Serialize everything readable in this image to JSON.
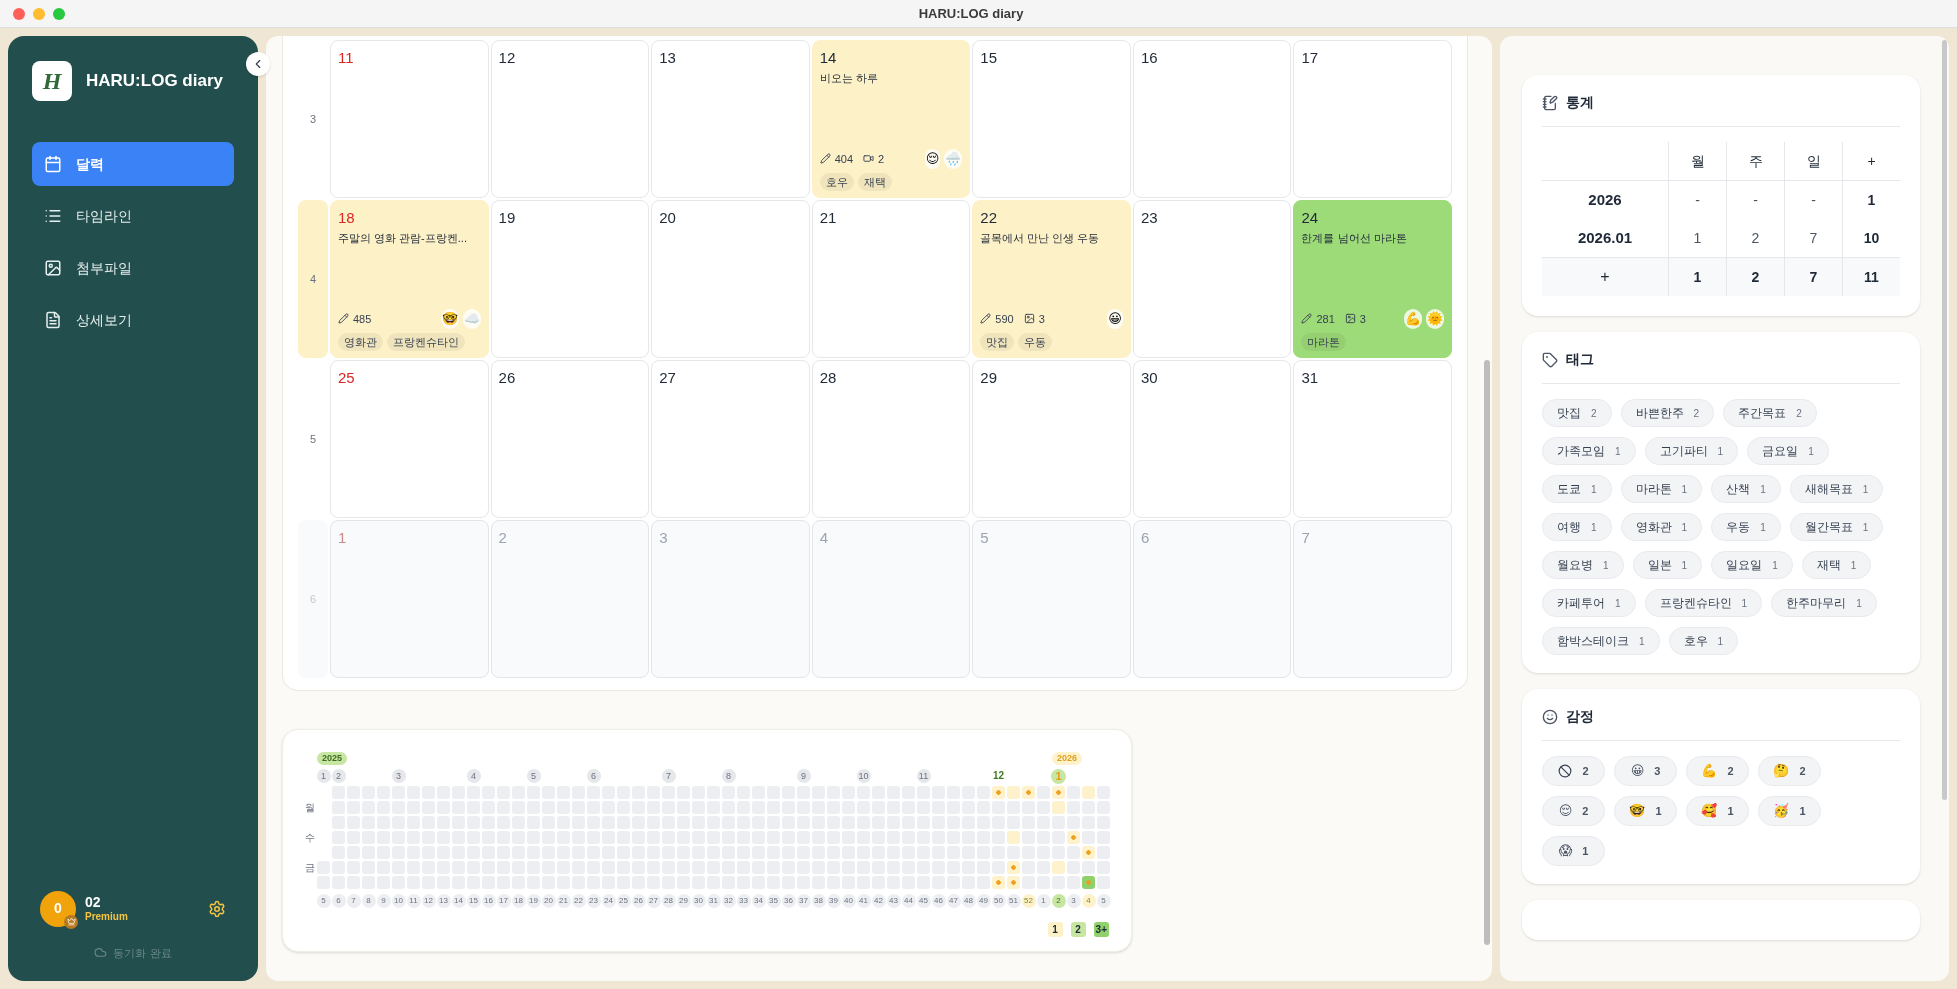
{
  "window": {
    "title": "HARU:LOG diary"
  },
  "sidebar": {
    "logo_letter": "H",
    "app_name": "HARU:LOG diary",
    "items": [
      {
        "label": "달력",
        "selected": true
      },
      {
        "label": "타임라인",
        "selected": false
      },
      {
        "label": "첨부파일",
        "selected": false
      },
      {
        "label": "상세보기",
        "selected": false
      }
    ],
    "user": {
      "avatar_text": "0",
      "name": "02",
      "plan": "Premium"
    },
    "sync_status": "동기화 완료"
  },
  "calendar": {
    "weeks": [
      {
        "label": "3",
        "highlighted": false,
        "days": [
          {
            "date": "11",
            "sunday": true,
            "other_month": false
          },
          {
            "date": "12",
            "sunday": false,
            "other_month": false
          },
          {
            "date": "13",
            "sunday": false,
            "other_month": false
          },
          {
            "date": "14",
            "sunday": false,
            "other_month": false,
            "entry": {
              "title": "비오는 하루",
              "color": "#fdf1c7",
              "chars": "404",
              "media": {
                "kind": "video",
                "count": "2"
              },
              "emojis": [
                "😌",
                "🌧️"
              ],
              "tags": [
                "호우",
                "재택"
              ]
            }
          },
          {
            "date": "15",
            "sunday": false,
            "other_month": false
          },
          {
            "date": "16",
            "sunday": false,
            "other_month": false
          },
          {
            "date": "17",
            "sunday": false,
            "other_month": false
          }
        ]
      },
      {
        "label": "4",
        "highlighted": true,
        "days": [
          {
            "date": "18",
            "sunday": true,
            "other_month": false,
            "entry": {
              "title": "주말의 영화 관람-프랑켄...",
              "color": "#fdf1c7",
              "chars": "485",
              "emojis": [
                "🤓",
                "☁️"
              ],
              "tags": [
                "영화관",
                "프랑켄슈타인"
              ]
            }
          },
          {
            "date": "19",
            "sunday": false,
            "other_month": false
          },
          {
            "date": "20",
            "sunday": false,
            "other_month": false
          },
          {
            "date": "21",
            "sunday": false,
            "other_month": false
          },
          {
            "date": "22",
            "sunday": false,
            "other_month": false,
            "entry": {
              "title": "골목에서 만난 인생 우동",
              "color": "#fdf1c7",
              "chars": "590",
              "media": {
                "kind": "image",
                "count": "3"
              },
              "emojis": [
                "😀"
              ],
              "tags": [
                "맛집",
                "우동"
              ]
            }
          },
          {
            "date": "23",
            "sunday": false,
            "other_month": false
          },
          {
            "date": "24",
            "sunday": false,
            "other_month": false,
            "entry": {
              "title": "한계를 넘어선 마라톤",
              "color": "#9ddb78",
              "chars": "281",
              "media": {
                "kind": "image",
                "count": "3"
              },
              "emojis": [
                "💪",
                "🌞"
              ],
              "tags": [
                "마라톤"
              ]
            }
          }
        ]
      },
      {
        "label": "5",
        "highlighted": false,
        "days": [
          {
            "date": "25",
            "sunday": true,
            "other_month": false
          },
          {
            "date": "26",
            "sunday": false,
            "other_month": false
          },
          {
            "date": "27",
            "sunday": false,
            "other_month": false
          },
          {
            "date": "28",
            "sunday": false,
            "other_month": false
          },
          {
            "date": "29",
            "sunday": false,
            "other_month": false
          },
          {
            "date": "30",
            "sunday": false,
            "other_month": false
          },
          {
            "date": "31",
            "sunday": false,
            "other_month": false
          }
        ]
      },
      {
        "label": "6",
        "highlighted": false,
        "days": [
          {
            "date": "1",
            "sunday": true,
            "other_month": true
          },
          {
            "date": "2",
            "sunday": false,
            "other_month": true
          },
          {
            "date": "3",
            "sunday": false,
            "other_month": true
          },
          {
            "date": "4",
            "sunday": false,
            "other_month": true
          },
          {
            "date": "5",
            "sunday": false,
            "other_month": true
          },
          {
            "date": "6",
            "sunday": false,
            "other_month": true
          },
          {
            "date": "7",
            "sunday": false,
            "other_month": true
          }
        ]
      }
    ]
  },
  "heatmap": {
    "day_labels": [
      "월",
      "수",
      "금"
    ],
    "weeks": [
      {
        "label": "5",
        "kind": "plain",
        "month": {
          "text": "1",
          "kind": "past"
        },
        "year": {
          "text": "2025",
          "kind": "past"
        },
        "days": [
          {
            "kind": "missing"
          },
          {
            "kind": "missing"
          },
          {
            "kind": "missing"
          },
          {
            "kind": "missing"
          },
          {
            "kind": "missing"
          },
          {
            "kind": "none"
          },
          {
            "kind": "none"
          }
        ]
      },
      {
        "label": "6",
        "kind": "plain",
        "month": {
          "text": "2",
          "kind": "past"
        },
        "days": [
          {
            "kind": "none"
          },
          {
            "kind": "none"
          },
          {
            "kind": "none"
          },
          {
            "kind": "none"
          },
          {
            "kind": "none"
          },
          {
            "kind": "none"
          },
          {
            "kind": "none"
          }
        ]
      },
      {
        "label": "7",
        "kind": "plain",
        "days": [
          {
            "kind": "none"
          },
          {
            "kind": "none"
          },
          {
            "kind": "none"
          },
          {
            "kind": "none"
          },
          {
            "kind": "none"
          },
          {
            "kind": "none"
          },
          {
            "kind": "none"
          }
        ]
      },
      {
        "label": "8",
        "kind": "plain",
        "days": [
          {
            "kind": "none"
          },
          {
            "kind": "none"
          },
          {
            "kind": "none"
          },
          {
            "kind": "none"
          },
          {
            "kind": "none"
          },
          {
            "kind": "none"
          },
          {
            "kind": "none"
          }
        ]
      },
      {
        "label": "9",
        "kind": "plain",
        "days": [
          {
            "kind": "none"
          },
          {
            "kind": "none"
          },
          {
            "kind": "none"
          },
          {
            "kind": "none"
          },
          {
            "kind": "none"
          },
          {
            "kind": "none"
          },
          {
            "kind": "none"
          }
        ]
      },
      {
        "label": "10",
        "kind": "plain",
        "month": {
          "text": "3",
          "kind": "past"
        },
        "days": [
          {
            "kind": "none"
          },
          {
            "kind": "none"
          },
          {
            "kind": "none"
          },
          {
            "kind": "none"
          },
          {
            "kind": "none"
          },
          {
            "kind": "none"
          },
          {
            "kind": "none"
          }
        ]
      },
      {
        "label": "11",
        "kind": "plain",
        "days": [
          {
            "kind": "none"
          },
          {
            "kind": "none"
          },
          {
            "kind": "none"
          },
          {
            "kind": "none"
          },
          {
            "kind": "none"
          },
          {
            "kind": "none"
          },
          {
            "kind": "none"
          }
        ]
      },
      {
        "label": "12",
        "kind": "plain",
        "days": [
          {
            "kind": "none"
          },
          {
            "kind": "none"
          },
          {
            "kind": "none"
          },
          {
            "kind": "none"
          },
          {
            "kind": "none"
          },
          {
            "kind": "none"
          },
          {
            "kind": "none"
          }
        ]
      },
      {
        "label": "13",
        "kind": "plain",
        "days": [
          {
            "kind": "none"
          },
          {
            "kind": "none"
          },
          {
            "kind": "none"
          },
          {
            "kind": "none"
          },
          {
            "kind": "none"
          },
          {
            "kind": "none"
          },
          {
            "kind": "none"
          }
        ]
      },
      {
        "label": "14",
        "kind": "plain",
        "days": [
          {
            "kind": "none"
          },
          {
            "kind": "none"
          },
          {
            "kind": "none"
          },
          {
            "kind": "none"
          },
          {
            "kind": "none"
          },
          {
            "kind": "none"
          },
          {
            "kind": "none"
          }
        ]
      },
      {
        "label": "15",
        "kind": "plain",
        "month": {
          "text": "4",
          "kind": "past"
        },
        "days": [
          {
            "kind": "none"
          },
          {
            "kind": "none"
          },
          {
            "kind": "none"
          },
          {
            "kind": "none"
          },
          {
            "kind": "none"
          },
          {
            "kind": "none"
          },
          {
            "kind": "none"
          }
        ]
      },
      {
        "label": "16",
        "kind": "plain",
        "days": [
          {
            "kind": "none"
          },
          {
            "kind": "none"
          },
          {
            "kind": "none"
          },
          {
            "kind": "none"
          },
          {
            "kind": "none"
          },
          {
            "kind": "none"
          },
          {
            "kind": "none"
          }
        ]
      },
      {
        "label": "17",
        "kind": "plain",
        "days": [
          {
            "kind": "none"
          },
          {
            "kind": "none"
          },
          {
            "kind": "none"
          },
          {
            "kind": "none"
          },
          {
            "kind": "none"
          },
          {
            "kind": "none"
          },
          {
            "kind": "none"
          }
        ]
      },
      {
        "label": "18",
        "kind": "plain",
        "days": [
          {
            "kind": "none"
          },
          {
            "kind": "none"
          },
          {
            "kind": "none"
          },
          {
            "kind": "none"
          },
          {
            "kind": "none"
          },
          {
            "kind": "none"
          },
          {
            "kind": "none"
          }
        ]
      },
      {
        "label": "19",
        "kind": "plain",
        "month": {
          "text": "5",
          "kind": "past"
        },
        "days": [
          {
            "kind": "none"
          },
          {
            "kind": "none"
          },
          {
            "kind": "none"
          },
          {
            "kind": "none"
          },
          {
            "kind": "none"
          },
          {
            "kind": "none"
          },
          {
            "kind": "none"
          }
        ]
      },
      {
        "label": "20",
        "kind": "plain",
        "days": [
          {
            "kind": "none"
          },
          {
            "kind": "none"
          },
          {
            "kind": "none"
          },
          {
            "kind": "none"
          },
          {
            "kind": "none"
          },
          {
            "kind": "none"
          },
          {
            "kind": "none"
          }
        ]
      },
      {
        "label": "21",
        "kind": "plain",
        "days": [
          {
            "kind": "none"
          },
          {
            "kind": "none"
          },
          {
            "kind": "none"
          },
          {
            "kind": "none"
          },
          {
            "kind": "none"
          },
          {
            "kind": "none"
          },
          {
            "kind": "none"
          }
        ]
      },
      {
        "label": "22",
        "kind": "plain",
        "days": [
          {
            "kind": "none"
          },
          {
            "kind": "none"
          },
          {
            "kind": "none"
          },
          {
            "kind": "none"
          },
          {
            "kind": "none"
          },
          {
            "kind": "none"
          },
          {
            "kind": "none"
          }
        ]
      },
      {
        "label": "23",
        "kind": "plain",
        "month": {
          "text": "6",
          "kind": "past"
        },
        "days": [
          {
            "kind": "none"
          },
          {
            "kind": "none"
          },
          {
            "kind": "none"
          },
          {
            "kind": "none"
          },
          {
            "kind": "none"
          },
          {
            "kind": "none"
          },
          {
            "kind": "none"
          }
        ]
      },
      {
        "label": "24",
        "kind": "plain",
        "days": [
          {
            "kind": "none"
          },
          {
            "kind": "none"
          },
          {
            "kind": "none"
          },
          {
            "kind": "none"
          },
          {
            "kind": "none"
          },
          {
            "kind": "none"
          },
          {
            "kind": "none"
          }
        ]
      },
      {
        "label": "25",
        "kind": "plain",
        "days": [
          {
            "kind": "none"
          },
          {
            "kind": "none"
          },
          {
            "kind": "none"
          },
          {
            "kind": "none"
          },
          {
            "kind": "none"
          },
          {
            "kind": "none"
          },
          {
            "kind": "none"
          }
        ]
      },
      {
        "label": "26",
        "kind": "plain",
        "days": [
          {
            "kind": "none"
          },
          {
            "kind": "none"
          },
          {
            "kind": "none"
          },
          {
            "kind": "none"
          },
          {
            "kind": "none"
          },
          {
            "kind": "none"
          },
          {
            "kind": "none"
          }
        ]
      },
      {
        "label": "27",
        "kind": "plain",
        "days": [
          {
            "kind": "none"
          },
          {
            "kind": "none"
          },
          {
            "kind": "none"
          },
          {
            "kind": "none"
          },
          {
            "kind": "none"
          },
          {
            "kind": "none"
          },
          {
            "kind": "none"
          }
        ]
      },
      {
        "label": "28",
        "kind": "plain",
        "month": {
          "text": "7",
          "kind": "past"
        },
        "days": [
          {
            "kind": "none"
          },
          {
            "kind": "none"
          },
          {
            "kind": "none"
          },
          {
            "kind": "none"
          },
          {
            "kind": "none"
          },
          {
            "kind": "none"
          },
          {
            "kind": "none"
          }
        ]
      },
      {
        "label": "29",
        "kind": "plain",
        "days": [
          {
            "kind": "none"
          },
          {
            "kind": "none"
          },
          {
            "kind": "none"
          },
          {
            "kind": "none"
          },
          {
            "kind": "none"
          },
          {
            "kind": "none"
          },
          {
            "kind": "none"
          }
        ]
      },
      {
        "label": "30",
        "kind": "plain",
        "days": [
          {
            "kind": "none"
          },
          {
            "kind": "none"
          },
          {
            "kind": "none"
          },
          {
            "kind": "none"
          },
          {
            "kind": "none"
          },
          {
            "kind": "none"
          },
          {
            "kind": "none"
          }
        ]
      },
      {
        "label": "31",
        "kind": "plain",
        "days": [
          {
            "kind": "none"
          },
          {
            "kind": "none"
          },
          {
            "kind": "none"
          },
          {
            "kind": "none"
          },
          {
            "kind": "none"
          },
          {
            "kind": "none"
          },
          {
            "kind": "none"
          }
        ]
      },
      {
        "label": "32",
        "kind": "plain",
        "month": {
          "text": "8",
          "kind": "past"
        },
        "days": [
          {
            "kind": "none"
          },
          {
            "kind": "none"
          },
          {
            "kind": "none"
          },
          {
            "kind": "none"
          },
          {
            "kind": "none"
          },
          {
            "kind": "none"
          },
          {
            "kind": "none"
          }
        ]
      },
      {
        "label": "33",
        "kind": "plain",
        "days": [
          {
            "kind": "none"
          },
          {
            "kind": "none"
          },
          {
            "kind": "none"
          },
          {
            "kind": "none"
          },
          {
            "kind": "none"
          },
          {
            "kind": "none"
          },
          {
            "kind": "none"
          }
        ]
      },
      {
        "label": "34",
        "kind": "plain",
        "days": [
          {
            "kind": "none"
          },
          {
            "kind": "none"
          },
          {
            "kind": "none"
          },
          {
            "kind": "none"
          },
          {
            "kind": "none"
          },
          {
            "kind": "none"
          },
          {
            "kind": "none"
          }
        ]
      },
      {
        "label": "35",
        "kind": "plain",
        "days": [
          {
            "kind": "none"
          },
          {
            "kind": "none"
          },
          {
            "kind": "none"
          },
          {
            "kind": "none"
          },
          {
            "kind": "none"
          },
          {
            "kind": "none"
          },
          {
            "kind": "none"
          }
        ]
      },
      {
        "label": "36",
        "kind": "plain",
        "days": [
          {
            "kind": "none"
          },
          {
            "kind": "none"
          },
          {
            "kind": "none"
          },
          {
            "kind": "none"
          },
          {
            "kind": "none"
          },
          {
            "kind": "none"
          },
          {
            "kind": "none"
          }
        ]
      },
      {
        "label": "37",
        "kind": "plain",
        "month": {
          "text": "9",
          "kind": "past"
        },
        "days": [
          {
            "kind": "none"
          },
          {
            "kind": "none"
          },
          {
            "kind": "none"
          },
          {
            "kind": "none"
          },
          {
            "kind": "none"
          },
          {
            "kind": "none"
          },
          {
            "kind": "none"
          }
        ]
      },
      {
        "label": "38",
        "kind": "plain",
        "days": [
          {
            "kind": "none"
          },
          {
            "kind": "none"
          },
          {
            "kind": "none"
          },
          {
            "kind": "none"
          },
          {
            "kind": "none"
          },
          {
            "kind": "none"
          },
          {
            "kind": "none"
          }
        ]
      },
      {
        "label": "39",
        "kind": "plain",
        "days": [
          {
            "kind": "none"
          },
          {
            "kind": "none"
          },
          {
            "kind": "none"
          },
          {
            "kind": "none"
          },
          {
            "kind": "none"
          },
          {
            "kind": "none"
          },
          {
            "kind": "none"
          }
        ]
      },
      {
        "label": "40",
        "kind": "plain",
        "days": [
          {
            "kind": "none"
          },
          {
            "kind": "none"
          },
          {
            "kind": "none"
          },
          {
            "kind": "none"
          },
          {
            "kind": "none"
          },
          {
            "kind": "none"
          },
          {
            "kind": "none"
          }
        ]
      },
      {
        "label": "41",
        "kind": "plain",
        "month": {
          "text": "10",
          "kind": "past"
        },
        "days": [
          {
            "kind": "none"
          },
          {
            "kind": "none"
          },
          {
            "kind": "none"
          },
          {
            "kind": "none"
          },
          {
            "kind": "none"
          },
          {
            "kind": "none"
          },
          {
            "kind": "none"
          }
        ]
      },
      {
        "label": "42",
        "kind": "plain",
        "days": [
          {
            "kind": "none"
          },
          {
            "kind": "none"
          },
          {
            "kind": "none"
          },
          {
            "kind": "none"
          },
          {
            "kind": "none"
          },
          {
            "kind": "none"
          },
          {
            "kind": "none"
          }
        ]
      },
      {
        "label": "43",
        "kind": "plain",
        "days": [
          {
            "kind": "none"
          },
          {
            "kind": "none"
          },
          {
            "kind": "none"
          },
          {
            "kind": "none"
          },
          {
            "kind": "none"
          },
          {
            "kind": "none"
          },
          {
            "kind": "none"
          }
        ]
      },
      {
        "label": "44",
        "kind": "plain",
        "days": [
          {
            "kind": "none"
          },
          {
            "kind": "none"
          },
          {
            "kind": "none"
          },
          {
            "kind": "none"
          },
          {
            "kind": "none"
          },
          {
            "kind": "none"
          },
          {
            "kind": "none"
          }
        ]
      },
      {
        "label": "45",
        "kind": "plain",
        "month": {
          "text": "11",
          "kind": "past"
        },
        "days": [
          {
            "kind": "none"
          },
          {
            "kind": "none"
          },
          {
            "kind": "none"
          },
          {
            "kind": "none"
          },
          {
            "kind": "none"
          },
          {
            "kind": "none"
          },
          {
            "kind": "none"
          }
        ]
      },
      {
        "label": "46",
        "kind": "plain",
        "days": [
          {
            "kind": "none"
          },
          {
            "kind": "none"
          },
          {
            "kind": "none"
          },
          {
            "kind": "none"
          },
          {
            "kind": "none"
          },
          {
            "kind": "none"
          },
          {
            "kind": "none"
          }
        ]
      },
      {
        "label": "47",
        "kind": "plain",
        "days": [
          {
            "kind": "none"
          },
          {
            "kind": "none"
          },
          {
            "kind": "none"
          },
          {
            "kind": "none"
          },
          {
            "kind": "none"
          },
          {
            "kind": "none"
          },
          {
            "kind": "none"
          }
        ]
      },
      {
        "label": "48",
        "kind": "plain",
        "days": [
          {
            "kind": "none"
          },
          {
            "kind": "none"
          },
          {
            "kind": "none"
          },
          {
            "kind": "none"
          },
          {
            "kind": "none"
          },
          {
            "kind": "none"
          },
          {
            "kind": "none"
          }
        ]
      },
      {
        "label": "49",
        "kind": "plain",
        "days": [
          {
            "kind": "none"
          },
          {
            "kind": "none"
          },
          {
            "kind": "none"
          },
          {
            "kind": "none"
          },
          {
            "kind": "none"
          },
          {
            "kind": "none"
          },
          {
            "kind": "none"
          }
        ]
      },
      {
        "label": "50",
        "kind": "plain",
        "month": {
          "text": "12",
          "kind": "recent"
        },
        "days": [
          {
            "kind": "dot"
          },
          {
            "kind": "none"
          },
          {
            "kind": "none"
          },
          {
            "kind": "none"
          },
          {
            "kind": "none"
          },
          {
            "kind": "none"
          },
          {
            "kind": "dot"
          }
        ]
      },
      {
        "label": "51",
        "kind": "plain",
        "days": [
          {
            "kind": "faint"
          },
          {
            "kind": "none"
          },
          {
            "kind": "none"
          },
          {
            "kind": "faint"
          },
          {
            "kind": "none"
          },
          {
            "kind": "dot"
          },
          {
            "kind": "dot"
          }
        ]
      },
      {
        "label": "52",
        "kind": "entry",
        "days": [
          {
            "kind": "dot"
          },
          {
            "kind": "none"
          },
          {
            "kind": "none"
          },
          {
            "kind": "none"
          },
          {
            "kind": "none"
          },
          {
            "kind": "none"
          },
          {
            "kind": "none"
          }
        ]
      },
      {
        "label": "1",
        "kind": "plain",
        "days": [
          {
            "kind": "none"
          },
          {
            "kind": "none"
          },
          {
            "kind": "none"
          },
          {
            "kind": "none"
          },
          {
            "kind": "none"
          },
          {
            "kind": "none"
          },
          {
            "kind": "none"
          }
        ]
      },
      {
        "label": "2",
        "kind": "current",
        "month": {
          "text": "1",
          "kind": "current"
        },
        "year": {
          "text": "2026",
          "kind": "current"
        },
        "days": [
          {
            "kind": "dot"
          },
          {
            "kind": "faint"
          },
          {
            "kind": "none"
          },
          {
            "kind": "none"
          },
          {
            "kind": "none"
          },
          {
            "kind": "faint"
          },
          {
            "kind": "none"
          }
        ]
      },
      {
        "label": "3",
        "kind": "plain",
        "days": [
          {
            "kind": "none"
          },
          {
            "kind": "none"
          },
          {
            "kind": "none"
          },
          {
            "kind": "dot"
          },
          {
            "kind": "none"
          },
          {
            "kind": "none"
          },
          {
            "kind": "none"
          }
        ]
      },
      {
        "label": "4",
        "kind": "entry",
        "days": [
          {
            "kind": "faint"
          },
          {
            "kind": "none"
          },
          {
            "kind": "none"
          },
          {
            "kind": "none"
          },
          {
            "kind": "dot"
          },
          {
            "kind": "none"
          },
          {
            "kind": "green"
          }
        ]
      },
      {
        "label": "5",
        "kind": "plain",
        "days": [
          {
            "kind": "none"
          },
          {
            "kind": "none"
          },
          {
            "kind": "none"
          },
          {
            "kind": "none"
          },
          {
            "kind": "none"
          },
          {
            "kind": "none"
          },
          {
            "kind": "none"
          }
        ]
      }
    ],
    "legend": [
      {
        "text": "1",
        "color": "#fdf1c7"
      },
      {
        "text": "2",
        "color": "#c6e6a2"
      },
      {
        "text": "3+",
        "color": "#8fd16a"
      }
    ]
  },
  "stats": {
    "title": "통계",
    "columns": [
      "월",
      "주",
      "일",
      "+"
    ],
    "rows": [
      {
        "label": "2026",
        "values": [
          "-",
          "-",
          "-",
          "1"
        ]
      },
      {
        "label": "2026.01",
        "values": [
          "1",
          "2",
          "7",
          "10"
        ]
      }
    ],
    "total": {
      "label": "+",
      "values": [
        "1",
        "2",
        "7",
        "11"
      ]
    }
  },
  "tags": {
    "title": "태그",
    "items": [
      {
        "name": "맛집",
        "count": "2"
      },
      {
        "name": "바쁜한주",
        "count": "2"
      },
      {
        "name": "주간목표",
        "count": "2"
      },
      {
        "name": "가족모임",
        "count": "1"
      },
      {
        "name": "고기파티",
        "count": "1"
      },
      {
        "name": "금요일",
        "count": "1"
      },
      {
        "name": "도쿄",
        "count": "1"
      },
      {
        "name": "마라톤",
        "count": "1"
      },
      {
        "name": "산책",
        "count": "1"
      },
      {
        "name": "새해목표",
        "count": "1"
      },
      {
        "name": "여행",
        "count": "1"
      },
      {
        "name": "영화관",
        "count": "1"
      },
      {
        "name": "우동",
        "count": "1"
      },
      {
        "name": "월간목표",
        "count": "1"
      },
      {
        "name": "월요병",
        "count": "1"
      },
      {
        "name": "일본",
        "count": "1"
      },
      {
        "name": "일요일",
        "count": "1"
      },
      {
        "name": "재택",
        "count": "1"
      },
      {
        "name": "카페투어",
        "count": "1"
      },
      {
        "name": "프랑켄슈타인",
        "count": "1"
      },
      {
        "name": "한주마무리",
        "count": "1"
      },
      {
        "name": "함박스테이크",
        "count": "1"
      },
      {
        "name": "호우",
        "count": "1"
      }
    ]
  },
  "emotions": {
    "title": "감정",
    "items": [
      {
        "kind": "none",
        "count": "2"
      },
      {
        "kind": "emoji",
        "emoji": "😀",
        "count": "3"
      },
      {
        "kind": "emoji",
        "emoji": "💪",
        "count": "2"
      },
      {
        "kind": "emoji",
        "emoji": "🤔",
        "count": "2"
      },
      {
        "kind": "emoji",
        "emoji": "😌",
        "count": "2"
      },
      {
        "kind": "emoji",
        "emoji": "🤓",
        "count": "1"
      },
      {
        "kind": "emoji",
        "emoji": "🥰",
        "count": "1"
      },
      {
        "kind": "emoji",
        "emoji": "🥳",
        "count": "1"
      },
      {
        "kind": "emoji",
        "emoji": "😱",
        "count": "1"
      }
    ]
  }
}
